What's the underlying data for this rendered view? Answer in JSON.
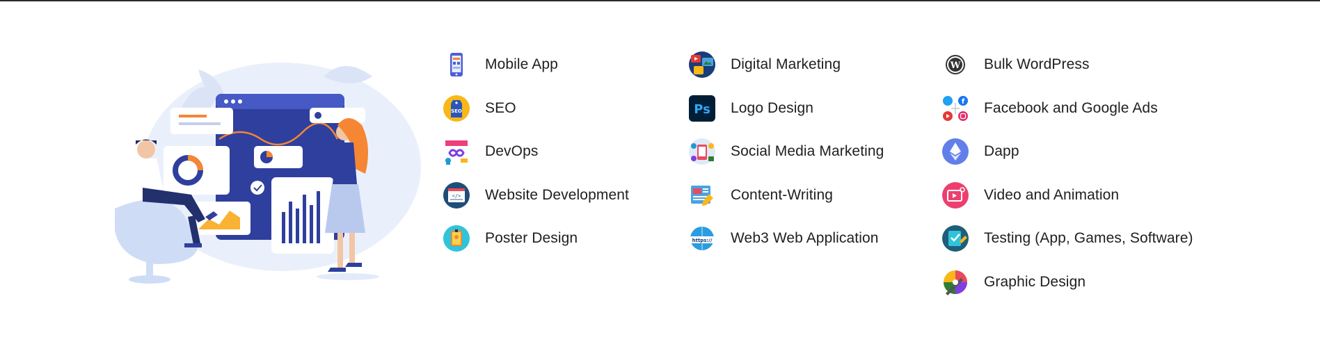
{
  "colors": {
    "primary": "#2f3f9e",
    "accent": "#f58634",
    "text": "#202020"
  },
  "services": {
    "column1": [
      {
        "label": "Mobile App",
        "icon": "mobile-app-icon"
      },
      {
        "label": "SEO",
        "icon": "seo-tag-icon"
      },
      {
        "label": "DevOps",
        "icon": "devops-infinity-icon"
      },
      {
        "label": "Website Development",
        "icon": "code-window-icon"
      },
      {
        "label": "Poster Design",
        "icon": "poster-icon"
      }
    ],
    "column2": [
      {
        "label": "Digital Marketing",
        "icon": "digital-marketing-icon"
      },
      {
        "label": "Logo Design",
        "icon": "photoshop-icon"
      },
      {
        "label": "Social Media Marketing",
        "icon": "social-media-icon"
      },
      {
        "label": "Content-Writing",
        "icon": "content-writing-icon"
      },
      {
        "label": "Web3 Web Application",
        "icon": "https-globe-icon"
      }
    ],
    "column3": [
      {
        "label": "Bulk WordPress",
        "icon": "wordpress-icon"
      },
      {
        "label": "Facebook and Google Ads",
        "icon": "social-ads-icon"
      },
      {
        "label": "Dapp",
        "icon": "ethereum-icon"
      },
      {
        "label": "Video and Animation",
        "icon": "video-icon"
      },
      {
        "label": "Testing (App, Games, Software)",
        "icon": "testing-icon"
      },
      {
        "label": "Graphic Design",
        "icon": "palette-icon"
      }
    ]
  },
  "hero": {
    "icon": "dashboard-illustration"
  }
}
